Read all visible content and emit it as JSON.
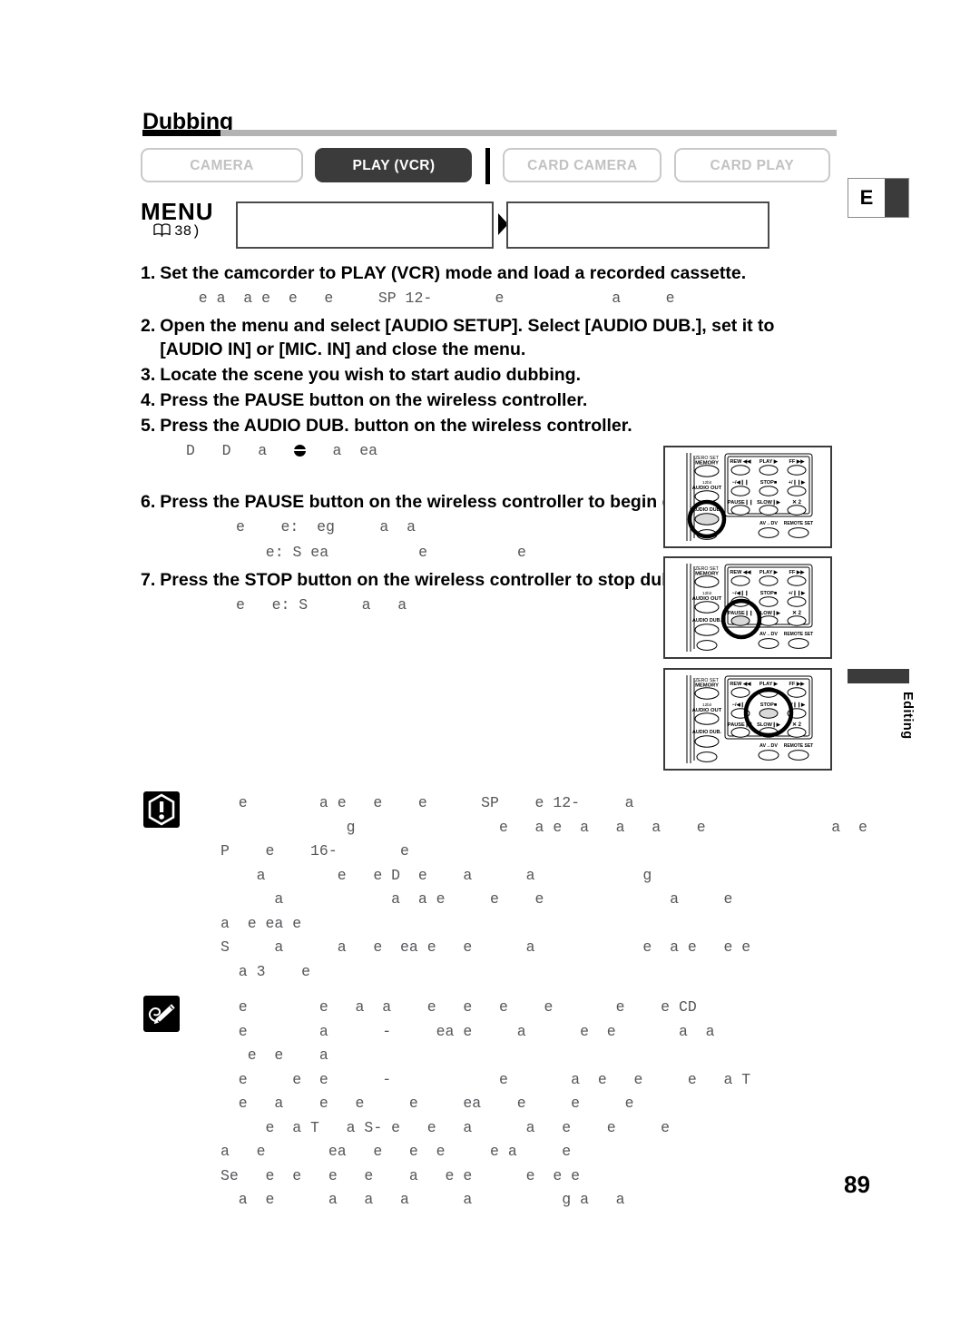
{
  "page": {
    "title": "Dubbing",
    "folio": "89",
    "language_tab": "E",
    "side_tab_label": "Editing"
  },
  "mode_pills": [
    {
      "label": "CAMERA",
      "active": false,
      "id": "camera"
    },
    {
      "label": "PLAY (VCR)",
      "active": true,
      "id": "play-vcr"
    },
    {
      "label": "CARD CAMERA",
      "active": false,
      "id": "card-camera"
    },
    {
      "label": "CARD PLAY",
      "active": false,
      "id": "card-play"
    }
  ],
  "menu_row": {
    "label": "MENU",
    "page_ref": "38)",
    "book_icon": "open-book-icon",
    "arrow_icon": "play-arrow-icon",
    "box_1_value": "",
    "box_2_value": ""
  },
  "steps": [
    {
      "num": "1.",
      "text": "Set the camcorder to PLAY (VCR) mode and load a recorded cassette.",
      "sub": [
        "  e a  a e  e   e     SP 12-       e            a     e"
      ]
    },
    {
      "num": "2.",
      "text": "Open the menu and select [AUDIO SETUP]. Select [AUDIO DUB.], set it to [AUDIO IN] or [MIC. IN] and close the menu.",
      "sub": []
    },
    {
      "num": "3.",
      "text": "Locate the scene you wish to start audio dubbing.",
      "sub": []
    },
    {
      "num": "4.",
      "text": "Press the PAUSE     button on the wireless controller.",
      "sub": []
    },
    {
      "num": "5.",
      "text": "Press the AUDIO DUB. button on the wireless controller.",
      "sub": [
        "D   D   a   ●   a  ea"
      ]
    },
    {
      "num": "6.",
      "text": "Press the PAUSE     button on the wireless controller to begin dubbing.",
      "sub": [
        "e    e:  eg     a  a",
        "  e: S ea          e          e"
      ]
    },
    {
      "num": "7.",
      "text": "Press the STOP     button on the wireless controller to stop dubbing.",
      "sub": [
        "e   e: S      a   a"
      ]
    }
  ],
  "remotes": [
    {
      "id": "remote-audio-dub",
      "highlight": "AUDIO DUB.",
      "buttons": [
        "ZERO SET MEMORY",
        "12bit AUDIO OUT",
        "AUDIO DUB.",
        "REW",
        "PLAY",
        "FF",
        "−/",
        "STOP",
        "+/",
        "PAUSE",
        "SLOW",
        "× 2",
        "AV→DV",
        "REMOTE SET"
      ]
    },
    {
      "id": "remote-pause",
      "highlight": "PAUSE",
      "buttons": [
        "ZERO SET MEMORY",
        "12bit AUDIO OUT",
        "AUDIO DUB.",
        "REW",
        "PLAY",
        "FF",
        "−/",
        "STOP",
        "+/",
        "PAUSE",
        "SLOW",
        "× 2",
        "AV→DV",
        "REMOTE SET"
      ]
    },
    {
      "id": "remote-stop",
      "highlight": "STOP",
      "buttons": [
        "ZERO SET MEMORY",
        "12bit AUDIO OUT",
        "AUDIO DUB.",
        "REW",
        "PLAY",
        "FF",
        "−/",
        "STOP",
        "+/",
        "PAUSE",
        "SLOW",
        "× 2",
        "AV→DV",
        "REMOTE SET"
      ]
    }
  ],
  "notes": {
    "warning": {
      "icon": "warning-exclamation-icon",
      "lines": [
        "  e        a e   e    e      SP    e 12-     a",
        "              g                e   a e  a   a   a    e              a  e",
        "P    e    16-       e",
        "    a        e   e D  e    a      a            g",
        "      a            a  a e     e    e              a     e",
        "a  e ea e",
        "S     a      a   e  ea e   e      a            e  a e   e e",
        "  a 3    e"
      ]
    },
    "info": {
      "icon": "pencil-note-icon",
      "lines": [
        "  e        e   a  a    e   e   e    e       e    e CD",
        "  e        a      -     ea e     a      e  e       a  a",
        "   e  e    a",
        "  e     e  e      -            e       a  e   e     e   a T",
        "  e   a    e   e     e     ea    e     e     e",
        "     e  a T   a S- e   e   a      a   e    e     e",
        "a   e       ea   e   e  e     e a     e",
        "Se   e  e   e   e    a   e e      e  e e",
        "  a  e      a   a   a      a          g a   a"
      ]
    }
  },
  "colors": {
    "accent_dark": "#3b3b3b",
    "rule_gray": "#b3b3b3",
    "body_gray": "#55565a",
    "ink": "#000000"
  }
}
